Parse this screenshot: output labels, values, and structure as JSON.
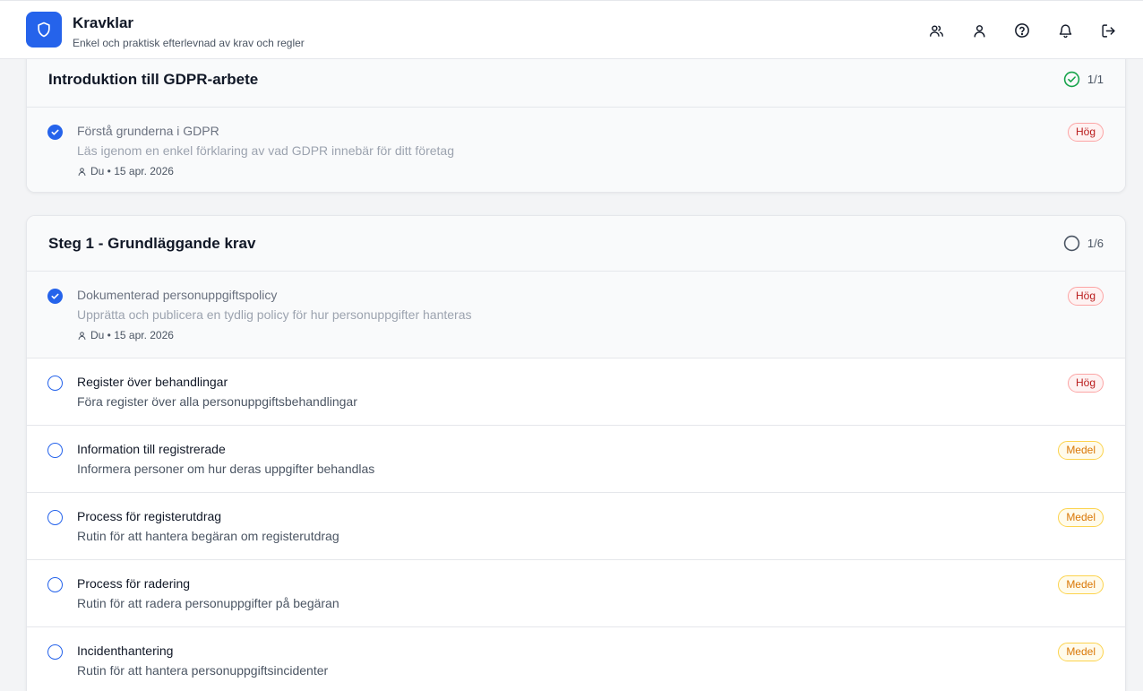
{
  "header": {
    "title": "Kravklar",
    "subtitle": "Enkel och praktisk efterlevnad av krav och regler",
    "icons": [
      "users-icon",
      "user-icon",
      "help-icon",
      "bell-icon",
      "logout-icon"
    ]
  },
  "sections": [
    {
      "title": "Introduktion till GDPR-arbete",
      "progress": "1/1",
      "status": "complete",
      "items": [
        {
          "title": "Förstå grunderna i GDPR",
          "description": "Läs igenom en enkel förklaring av vad GDPR innebär för ditt företag",
          "priority": "Hög",
          "done": true,
          "meta": "Du • 15 apr. 2026"
        }
      ]
    },
    {
      "title": "Steg 1 - Grundläggande krav",
      "progress": "1/6",
      "status": "incomplete",
      "items": [
        {
          "title": "Dokumenterad personuppgiftspolicy",
          "description": "Upprätta och publicera en tydlig policy för hur personuppgifter hanteras",
          "priority": "Hög",
          "done": true,
          "meta": "Du • 15 apr. 2026"
        },
        {
          "title": "Register över behandlingar",
          "description": "Föra register över alla personuppgiftsbehandlingar",
          "priority": "Hög",
          "done": false
        },
        {
          "title": "Information till registrerade",
          "description": "Informera personer om hur deras uppgifter behandlas",
          "priority": "Medel",
          "done": false
        },
        {
          "title": "Process för registerutdrag",
          "description": "Rutin för att hantera begäran om registerutdrag",
          "priority": "Medel",
          "done": false
        },
        {
          "title": "Process för radering",
          "description": "Rutin för att radera personuppgifter på begäran",
          "priority": "Medel",
          "done": false
        },
        {
          "title": "Incidenthantering",
          "description": "Rutin för att hantera personuppgiftsincidenter",
          "priority": "Medel",
          "done": false
        }
      ]
    }
  ],
  "colors": {
    "accent": "#2563eb",
    "success": "#16a34a",
    "high_priority": "#b91c1c",
    "medium_priority": "#d97706"
  }
}
